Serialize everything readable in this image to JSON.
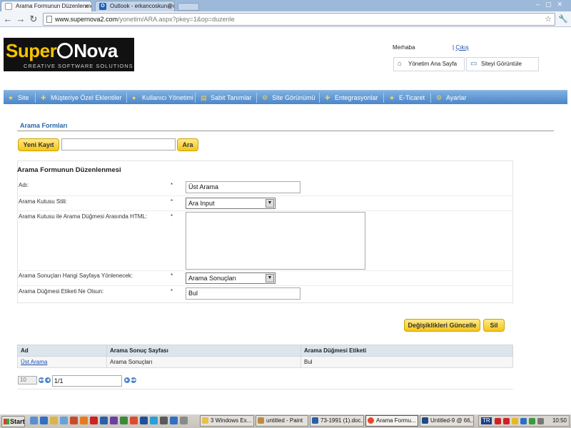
{
  "browser": {
    "tabs": [
      {
        "title": "Arama Formunun Düzenlenme",
        "active": true
      },
      {
        "title": "Outlook - erkancoskun@outlo",
        "active": false
      }
    ],
    "url_host": "www.supernova2.com",
    "url_path": "/yonetim/ARA.aspx?pkey=1&op=duzenle"
  },
  "header": {
    "logo_text_1": "Super",
    "logo_text_2": "Nova",
    "logo_tagline": "CREATIVE SOFTWARE SOLUTIONS",
    "greeting": "Merhaba",
    "separator": "|",
    "logout": "Çıkış",
    "quick_links": {
      "home": "Yönetim Ana Sayfa",
      "view_site": "Siteyi Görüntüle"
    }
  },
  "menu": {
    "items": [
      "Site",
      "Müşteriye Özel Eklentiler",
      "Kullanıcı Yönetimi",
      "Sabit Tanımlar",
      "Site Görünümü",
      "Entegrasyonlar",
      "E-Ticaret",
      "Ayarlar"
    ]
  },
  "page": {
    "section_title": "Arama Formları",
    "new_button": "Yeni Kayıt",
    "search_button": "Ara",
    "search_value": ""
  },
  "form": {
    "title": "Arama Formunun Düzenlenmesi",
    "required_mark": "*",
    "fields": {
      "name": {
        "label": "Adı:",
        "value": "Üst Arama"
      },
      "style": {
        "label": "Arama Kutusu Stili:",
        "value": "Ara Input"
      },
      "html": {
        "label": "Arama Kutusu ile Arama Düğmesi Arasında HTML:",
        "value": ""
      },
      "redirect": {
        "label": "Arama Sonuçları Hangi Sayfaya Yönlenecek:",
        "value": "Arama Sonuçları"
      },
      "button_label": {
        "label": "Arama Düğmesi Etiketi Ne Olsun:",
        "value": "Bul"
      }
    },
    "update_button": "Değişiklikleri Güncelle",
    "delete_button": "Sil"
  },
  "grid": {
    "columns": [
      "Ad",
      "Arama Sonuç Sayfası",
      "Arama Düğmesi Etiketi"
    ],
    "rows": [
      [
        "Üst Arama",
        "Arama Sonuçları",
        "Bul"
      ]
    ],
    "page_size": "10",
    "page_value": "1/1"
  },
  "taskbar": {
    "start": "Start",
    "tasks": [
      "3 Windows Ex...",
      "untitled - Paint",
      "73-1991 (1).doc...",
      "Arama Formu...",
      "Untitled-9 @ 66,..."
    ],
    "tray_lang": "TR",
    "clock": "10:50"
  },
  "colors": {
    "menu_bar": "#4b86c8",
    "button_yellow": "#f5c518",
    "link_blue": "#1a4fb0",
    "section_title": "#2a66a8"
  }
}
